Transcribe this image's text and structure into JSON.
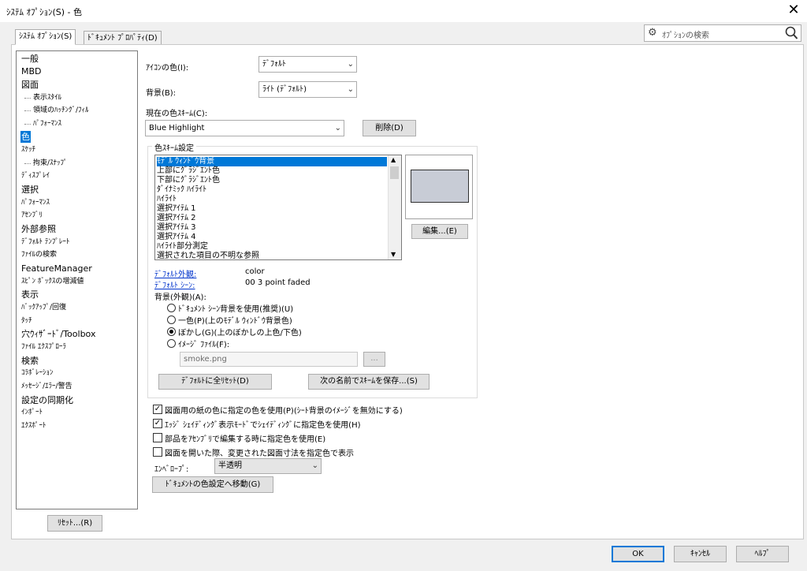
{
  "window": {
    "title": "ｼｽﾃﾑ ｵﾌﾟｼｮﾝ(S) - 色",
    "close_glyph": "✕"
  },
  "tabs": [
    {
      "label": "ｼｽﾃﾑ ｵﾌﾟｼｮﾝ(S)",
      "active": true
    },
    {
      "label": "ﾄﾞｷｭﾒﾝﾄ ﾌﾟﾛﾊﾟﾃｨ(D)",
      "active": false
    }
  ],
  "search": {
    "placeholder": "ｵﾌﾟｼｮﾝの検索",
    "icon": "gear-icon",
    "button_icon": "magnifier-icon"
  },
  "tree": {
    "items": [
      {
        "label": "一般"
      },
      {
        "label": "MBD"
      },
      {
        "label": "図面"
      },
      {
        "label": "表示ｽﾀｲﾙ"
      },
      {
        "label": "領域のﾊｯﾁﾝｸﾞ/ﾌｨﾙ"
      },
      {
        "label": "ﾊﾟﾌｫｰﾏﾝｽ"
      },
      {
        "label": "色",
        "selected": true
      },
      {
        "label": "ｽｹｯﾁ"
      },
      {
        "label": "拘束/ｽﾅｯﾌﾟ"
      },
      {
        "label": "ﾃﾞｨｽﾌﾟﾚｲ"
      },
      {
        "label": "選択"
      },
      {
        "label": "ﾊﾟﾌｫｰﾏﾝｽ"
      },
      {
        "label": "ｱｾﾝﾌﾞﾘ"
      },
      {
        "label": "外部参照"
      },
      {
        "label": "ﾃﾞﾌｫﾙﾄ ﾃﾝﾌﾟﾚｰﾄ"
      },
      {
        "label": "ﾌｧｲﾙの検索"
      },
      {
        "label": "FeatureManager"
      },
      {
        "label": "ｽﾋﾟﾝ ﾎﾞｯｸｽの増減値"
      },
      {
        "label": "表示"
      },
      {
        "label": "ﾊﾞｯｸｱｯﾌﾟ/回復"
      },
      {
        "label": "ﾀｯﾁ"
      },
      {
        "label": "穴ｳｨｻﾞｰﾄﾞ/Toolbox"
      },
      {
        "label": "ﾌｧｲﾙ ｴｸｽﾌﾟﾛｰﾗ"
      },
      {
        "label": "検索"
      },
      {
        "label": "ｺﾗﾎﾞﾚｰｼｮﾝ"
      },
      {
        "label": "ﾒｯｾｰｼﾞ/ｴﾗｰ/警告"
      },
      {
        "label": "設定の同期化"
      },
      {
        "label": "ｲﾝﾎﾟｰﾄ"
      },
      {
        "label": "ｴｸｽﾎﾟｰﾄ"
      }
    ],
    "reset_label": "ﾘｾｯﾄ...(R)"
  },
  "settings": {
    "icon_color_label": "ｱｲｺﾝの色(I):",
    "icon_color_value": "ﾃﾞﾌｫﾙﾄ",
    "background_label": "背景(B):",
    "background_value": "ﾗｲﾄ (ﾃﾞﾌｫﾙﾄ)",
    "scheme_label": "現在の色ｽｷｰﾑ(C):",
    "scheme_value": "Blue Highlight",
    "delete_label": "削除(D)"
  },
  "scheme_group": {
    "title": "色ｽｷｰﾑ設定",
    "items": [
      {
        "label": "ﾓﾃﾞﾙ ｳｨﾝﾄﾞｳ背景",
        "selected": true
      },
      {
        "label": "上部にｸﾞﾗｼﾞｴﾝﾄ色"
      },
      {
        "label": "下部にｸﾞﾗｼﾞｴﾝﾄ色"
      },
      {
        "label": "ﾀﾞｲﾅﾐｯｸ ﾊｲﾗｲﾄ"
      },
      {
        "label": "ﾊｲﾗｲﾄ"
      },
      {
        "label": "選択ｱｲﾃﾑ 1"
      },
      {
        "label": "選択ｱｲﾃﾑ 2"
      },
      {
        "label": "選択ｱｲﾃﾑ 3"
      },
      {
        "label": "選択ｱｲﾃﾑ 4"
      },
      {
        "label": "ﾊｲﾗｲﾄ部分測定"
      },
      {
        "label": "選択された項目の不明な参照"
      }
    ],
    "preview_color": "#c8ccd6",
    "edit_label": "編集...(E)",
    "default_appearance_link": "ﾃﾞﾌｫﾙﾄ外観:",
    "default_appearance_value": "color",
    "default_scene_link": "ﾃﾞﾌｫﾙﾄ ｼｰﾝ:",
    "default_scene_value": "00 3 point faded",
    "bg_appearance_label": "背景(外観)(A):",
    "radios": [
      {
        "label": "ﾄﾞｷｭﾒﾝﾄ ｼｰﾝ背景を使用(推奨)(U)",
        "checked": false
      },
      {
        "label": "一色(P)(上のﾓﾃﾞﾙ ｳｨﾝﾄﾞｳ背景色)",
        "checked": false
      },
      {
        "label": "ぼかし(G)(上のぼかしの上色/下色)",
        "checked": true
      },
      {
        "label": "ｲﾒｰｼﾞ ﾌｧｲﾙ(F):",
        "checked": false
      }
    ],
    "image_file_value": "smoke.png",
    "browse_label": "...",
    "reset_all_label": "ﾃﾞﾌｫﾙﾄに全ﾘｾｯﾄ(D)",
    "save_as_label": "次の名前でｽｷｰﾑを保存...(S)"
  },
  "checkboxes": [
    {
      "label": "図面用の紙の色に指定の色を使用(P)(ｼｰﾄ背景のｲﾒｰｼﾞを無効にする)",
      "checked": true
    },
    {
      "label": "ｴｯｼﾞ ｼｪｲﾃﾞｨﾝｸﾞ表示ﾓｰﾄﾞでｼｪｲﾃﾞｨﾝｸﾞに指定色を使用(H)",
      "checked": true
    },
    {
      "label": "部品をｱｾﾝﾌﾞﾘで編集する時に指定色を使用(E)",
      "checked": false
    },
    {
      "label": "図面を開いた際、変更された図面寸法を指定色で表示",
      "checked": false
    }
  ],
  "envelope": {
    "label": "ｴﾝﾍﾞﾛｰﾌﾟ:",
    "value": "半透明"
  },
  "doc_color_label": "ﾄﾞｷｭﾒﾝﾄの色設定へ移動(G)",
  "footer": {
    "ok": "OK",
    "cancel": "ｷｬﾝｾﾙ",
    "help": "ﾍﾙﾌﾟ"
  },
  "check_glyph": "✓",
  "arrow_glyph": "⌄"
}
